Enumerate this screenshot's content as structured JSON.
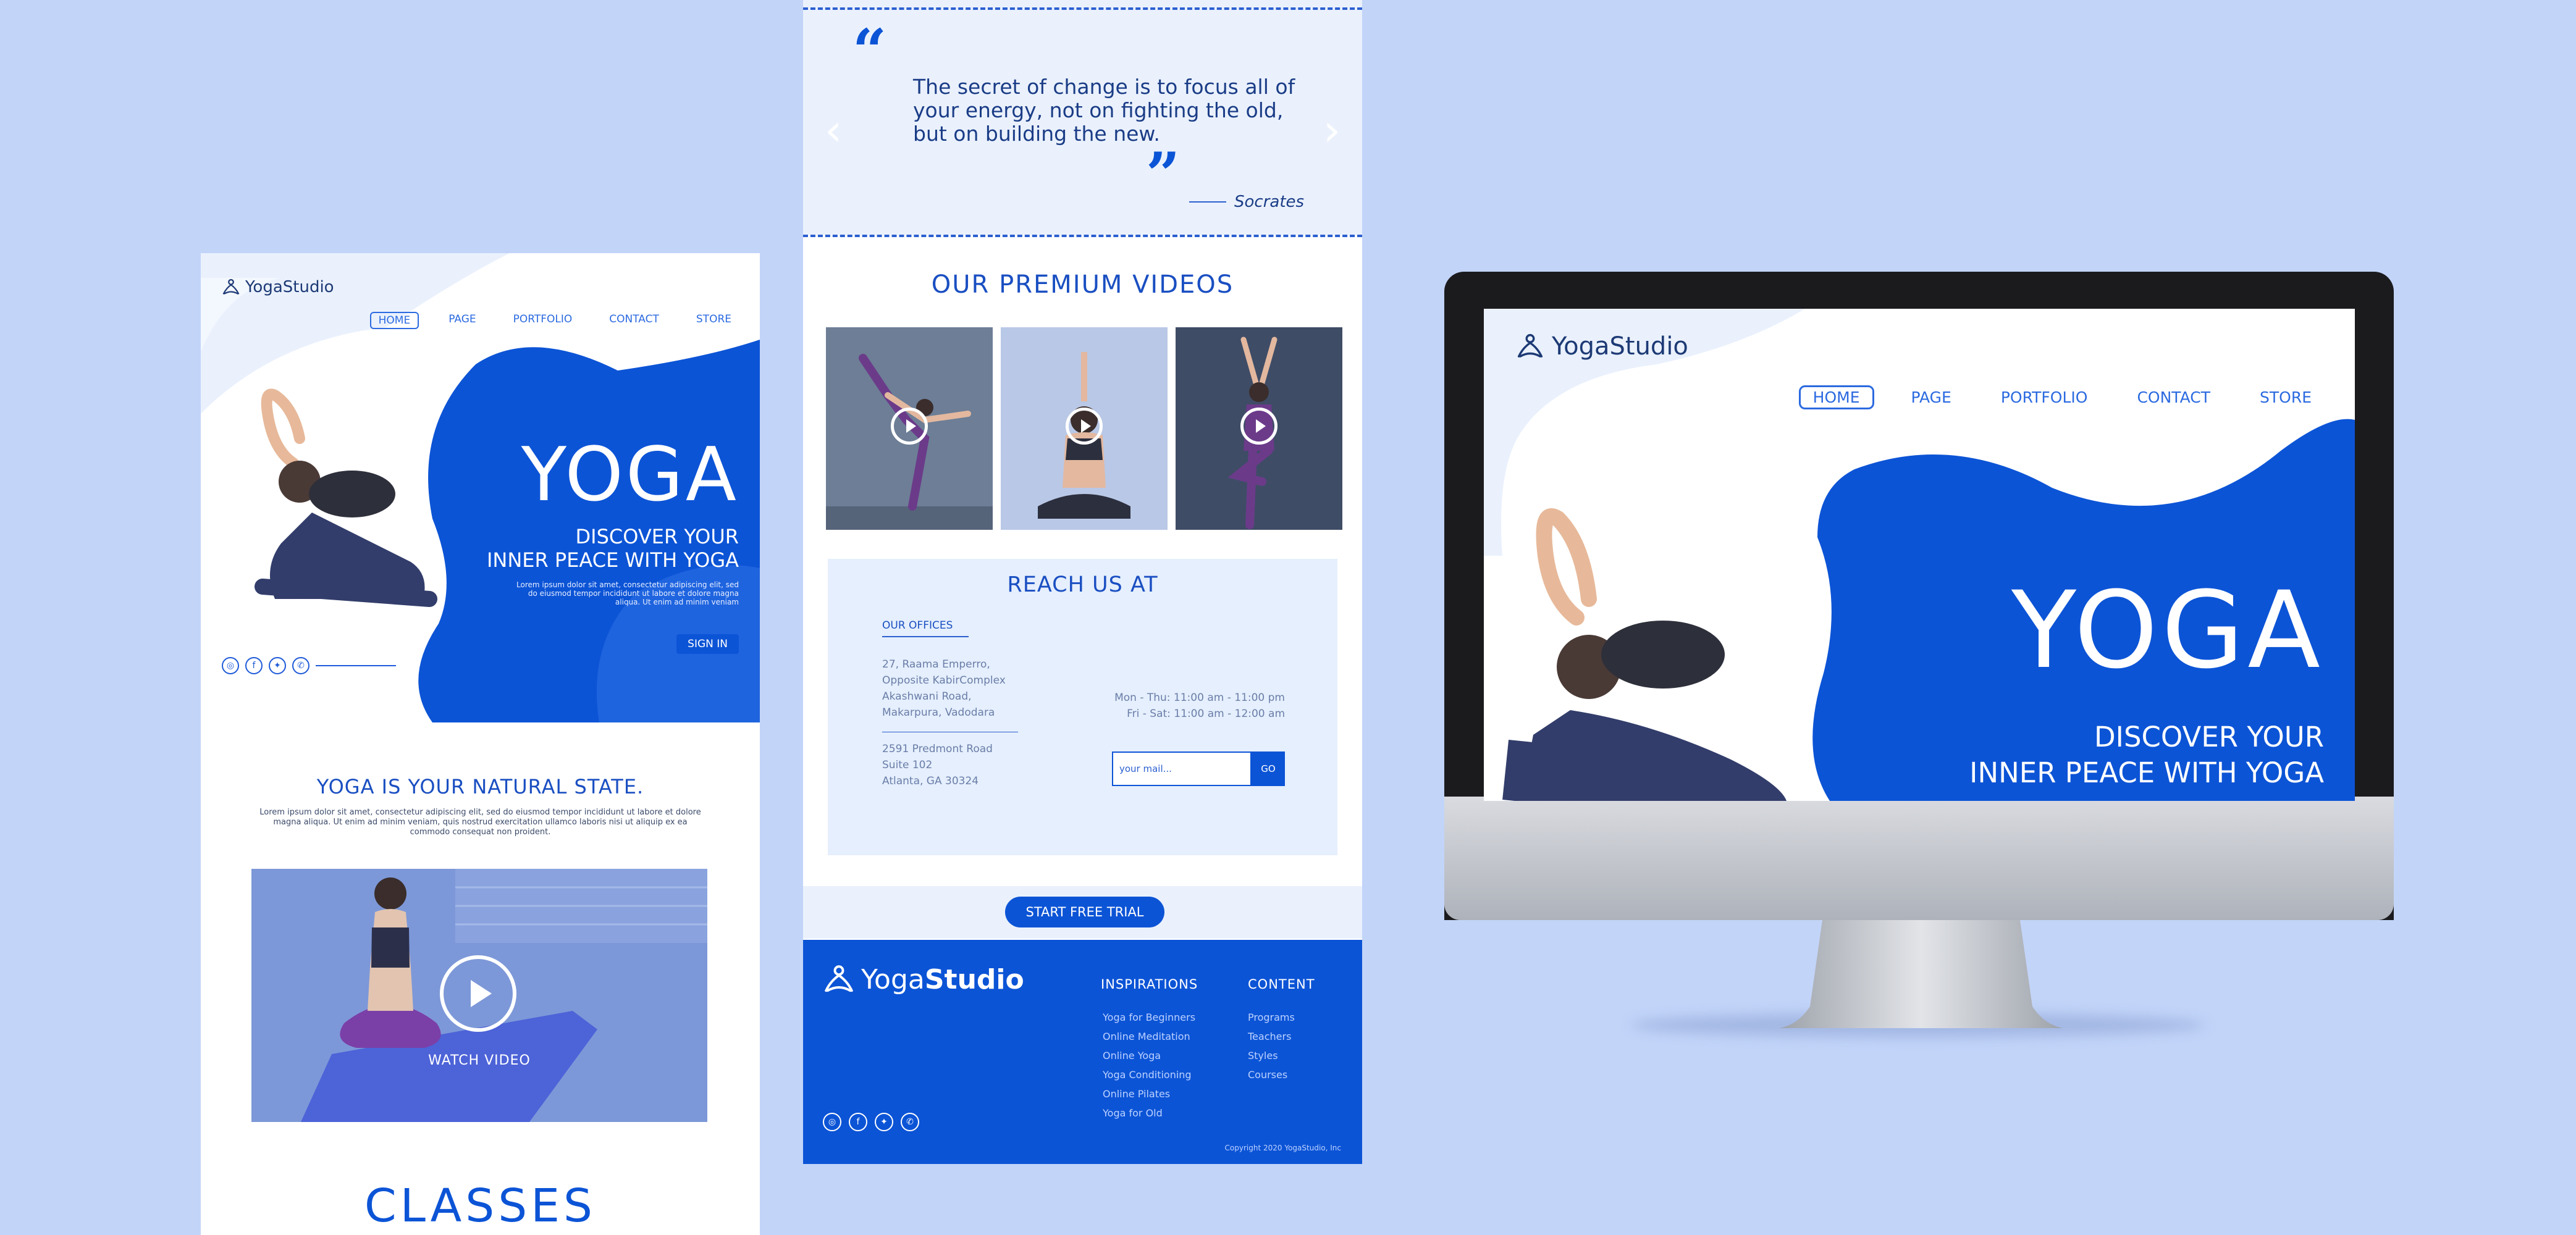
{
  "colors": {
    "background": "#c2d4f8",
    "brand_blue": "#0c54d6"
  },
  "brand": {
    "name": "YogaStudio",
    "name_part1": "Yoga",
    "name_part2": "Studio"
  },
  "nav": {
    "home": "HOME",
    "page": "PAGE",
    "portfolio": "PORTFOLIO",
    "contact": "CONTACT",
    "store": "STORE"
  },
  "hero": {
    "title": "YOGA",
    "tagline_line1": "DISCOVER YOUR",
    "tagline_line2": "INNER PEACE WITH YOGA",
    "lorem": "Lorem ipsum dolor sit amet, consectetur adipiscing elit, sed do eiusmod tempor incididunt ut labore et dolore magna aliqua. Ut enim ad minim veniam",
    "signin": "SIGN IN"
  },
  "intro": {
    "heading": "YOGA IS YOUR NATURAL STATE.",
    "text": "Lorem ipsum dolor sit amet, consectetur adipiscing elit, sed do eiusmod tempor incididunt ut labore et dolore magna aliqua. Ut enim ad minim veniam, quis nostrud exercitation ullamco laboris nisi ut aliquip ex ea commodo consequat non proident.",
    "watch_video": "WATCH VIDEO"
  },
  "classes": "CLASSES",
  "quote": {
    "text": "The secret of change is to focus all of your energy, not on fighting the old, but on building the new.",
    "author": "Socrates"
  },
  "videos": {
    "heading": "OUR PREMIUM VIDEOS"
  },
  "reach": {
    "heading": "REACH US AT",
    "offices_heading": "OUR OFFICES",
    "address1": [
      "27, Raama Emperro,",
      "Opposite KabirComplex",
      "Akashwani Road,",
      "Makarpura, Vadodara"
    ],
    "address2": [
      "2591 Predmont Road",
      "Suite 102",
      "Atlanta, GA 30324"
    ],
    "hours1": "Mon - Thu: 11:00 am - 11:00 pm",
    "hours2": "Fri - Sat: 11:00 am - 12:00 am",
    "email_placeholder": "your mail...",
    "go": "GO"
  },
  "trial": "START FREE TRIAL",
  "footer": {
    "inspirations_heading": "INSPIRATIONS",
    "inspirations": [
      "Yoga for Beginners",
      "Online Meditation",
      "Online Yoga",
      "Yoga Conditioning",
      "Online Pilates",
      "Yoga for Old"
    ],
    "content_heading": "CONTENT",
    "content": [
      "Programs",
      "Teachers",
      "Styles",
      "Courses"
    ],
    "copyright": "Copyright 2020 YogaStudio, Inc"
  }
}
